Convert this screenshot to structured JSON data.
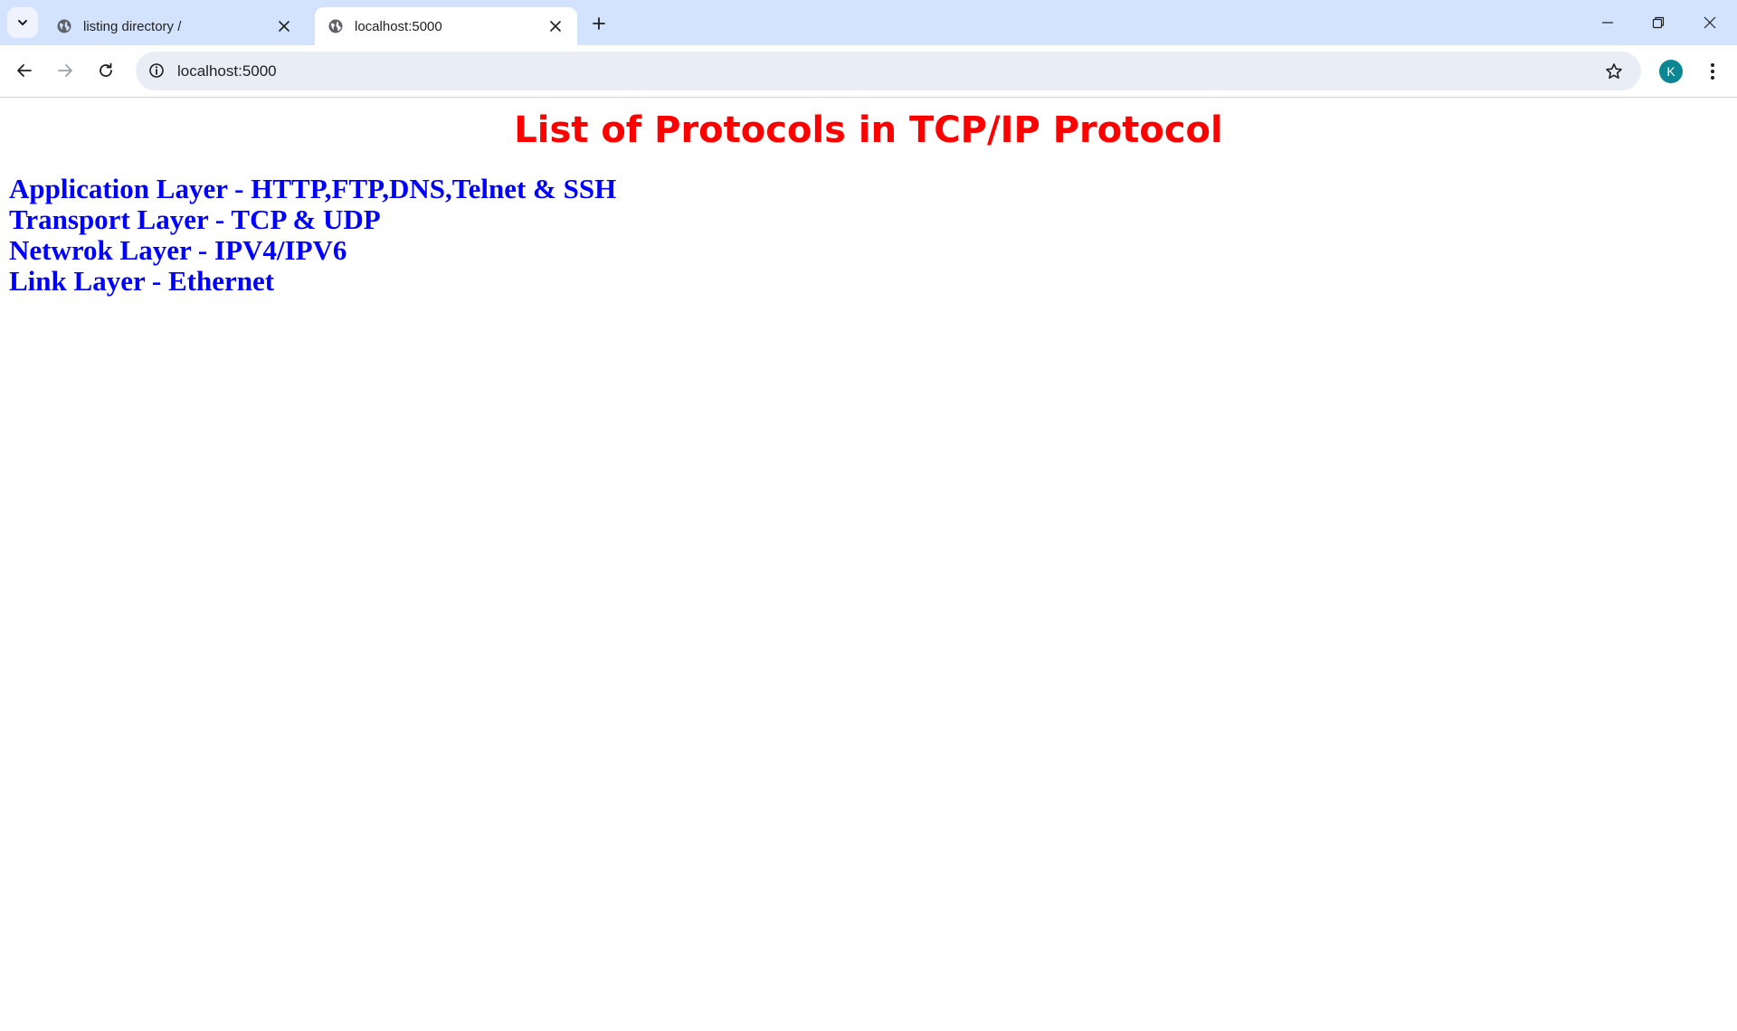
{
  "browser": {
    "tabs": [
      {
        "title": "listing directory /",
        "active": false,
        "favicon": "globe-icon"
      },
      {
        "title": "localhost:5000",
        "active": true,
        "favicon": "globe-icon"
      }
    ],
    "address": "localhost:5000",
    "profile_initial": "K",
    "profile_color": "#0b8793",
    "tabstrip_color": "#d3e3fd"
  },
  "page": {
    "title": "List of Protocols in TCP/IP Protocol",
    "title_color": "#ff0000",
    "items_color": "#0000ff",
    "items": [
      "Application Layer - HTTP,FTP,DNS,Telnet & SSH",
      "Transport Layer - TCP & UDP",
      "Netwrok Layer - IPV4/IPV6",
      "Link Layer - Ethernet"
    ]
  }
}
